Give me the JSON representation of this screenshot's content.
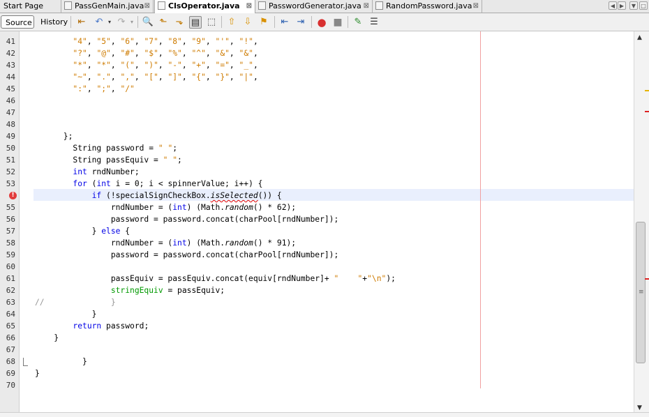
{
  "tabs": [
    {
      "label": "Start Page",
      "active": false
    },
    {
      "label": "PassGenMain.java",
      "active": false
    },
    {
      "label": "ClsOperator.java",
      "active": true
    },
    {
      "label": "PasswordGenerator.java",
      "active": false
    },
    {
      "label": "RandomPassword.java",
      "active": false
    }
  ],
  "tab_close_glyph": "⊠",
  "toolbar": {
    "source_label": "Source",
    "history_label": "History"
  },
  "colors": {
    "keyword": "#0000e6",
    "string": "#ce7b00",
    "field": "#009900",
    "error": "#e23b3b",
    "current_line": "#e9effd"
  },
  "editor": {
    "lines": [
      {
        "n": "41",
        "html": "        <span class=\"str\">\"4\"</span>, <span class=\"str\">\"5\"</span>, <span class=\"str\">\"6\"</span>, <span class=\"str\">\"7\"</span>, <span class=\"str\">\"8\"</span>, <span class=\"str\">\"9\"</span>, <span class=\"str\">\"'\"</span>, <span class=\"str\">\"!\"</span>,"
      },
      {
        "n": "42",
        "html": "        <span class=\"str\">\"?\"</span>, <span class=\"str\">\"@\"</span>, <span class=\"str\">\"#\"</span>, <span class=\"str\">\"$\"</span>, <span class=\"str\">\"%\"</span>, <span class=\"str\">\"^\"</span>, <span class=\"str\">\"&amp;\"</span>, <span class=\"str\">\"&amp;\"</span>,"
      },
      {
        "n": "43",
        "html": "        <span class=\"str\">\"*\"</span>, <span class=\"str\">\"*\"</span>, <span class=\"str\">\"(\"</span>, <span class=\"str\">\")\"</span>, <span class=\"str\">\"-\"</span>, <span class=\"str\">\"+\"</span>, <span class=\"str\">\"=\"</span>, <span class=\"str\">\"_\"</span>,"
      },
      {
        "n": "44",
        "html": "        <span class=\"str\">\"~\"</span>, <span class=\"str\">\".\"</span>, <span class=\"str\">\",\"</span>, <span class=\"str\">\"[\"</span>, <span class=\"str\">\"]\"</span>, <span class=\"str\">\"{\"</span>, <span class=\"str\">\"}\"</span>, <span class=\"str\">\"|\"</span>,"
      },
      {
        "n": "45",
        "html": "        <span class=\"str\">\":\"</span>, <span class=\"str\">\";\"</span>, <span class=\"str\">\"/\"</span>"
      },
      {
        "n": "46",
        "html": ""
      },
      {
        "n": "47",
        "html": ""
      },
      {
        "n": "48",
        "html": ""
      },
      {
        "n": "49",
        "html": "      };"
      },
      {
        "n": "50",
        "html": "        String password = <span class=\"str\">\" \"</span>;"
      },
      {
        "n": "51",
        "html": "        String passEquiv = <span class=\"str\">\" \"</span>;"
      },
      {
        "n": "52",
        "html": "        <span class=\"kw\">int</span> rndNumber;"
      },
      {
        "n": "53",
        "html": "        <span class=\"kw\">for</span> (<span class=\"kw\">int</span> i = 0; i &lt; spinnerValue; i++) {"
      },
      {
        "n": "54",
        "html": "            <span class=\"kw\">if</span> (!specialSignCheckBox.<span class=\"it wavy\">isSelected</span>()) {",
        "error": true
      },
      {
        "n": "55",
        "html": "                rndNumber = (<span class=\"kw\">int</span>) (Math.<span class=\"it\">random</span>() * 62);"
      },
      {
        "n": "56",
        "html": "                password = password.concat(charPool[rndNumber]);"
      },
      {
        "n": "57",
        "html": "            } <span class=\"kw\">else</span> {"
      },
      {
        "n": "58",
        "html": "                rndNumber = (<span class=\"kw\">int</span>) (Math.<span class=\"it\">random</span>() * 91);"
      },
      {
        "n": "59",
        "html": "                password = password.concat(charPool[rndNumber]);"
      },
      {
        "n": "60",
        "html": ""
      },
      {
        "n": "61",
        "html": "                passEquiv = passEquiv.concat(equiv[rndNumber]+ <span class=\"str\">\"    \"</span>+<span class=\"str\">\"\\n\"</span>);"
      },
      {
        "n": "62",
        "html": "                <span class=\"fld\">stringEquiv</span> = passEquiv;"
      },
      {
        "n": "63",
        "html": "<span class=\"cm\">//              }</span>"
      },
      {
        "n": "64",
        "html": "            }"
      },
      {
        "n": "65",
        "html": "        <span class=\"kw\">return</span> password;"
      },
      {
        "n": "66",
        "html": "    }"
      },
      {
        "n": "67",
        "html": ""
      },
      {
        "n": "68",
        "html": "          }"
      },
      {
        "n": "69",
        "html": "}"
      },
      {
        "n": "70",
        "html": ""
      }
    ]
  }
}
